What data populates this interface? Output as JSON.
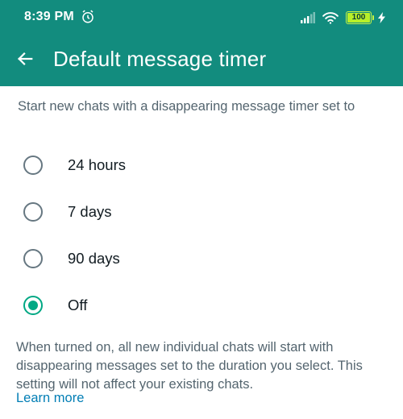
{
  "status_bar": {
    "time": "8:39 PM",
    "battery_level": "100",
    "icons": [
      "alarm-icon",
      "signal-icon",
      "wifi-icon",
      "battery-icon",
      "charging-bolt-icon"
    ]
  },
  "header": {
    "title": "Default message timer",
    "back_icon": "back-arrow-icon",
    "background_color": "#128c7e"
  },
  "intro_text": "Start new chats with a disappearing message timer set to",
  "options": [
    {
      "label": "24 hours",
      "selected": false
    },
    {
      "label": "7 days",
      "selected": false
    },
    {
      "label": "90 days",
      "selected": false
    },
    {
      "label": "Off",
      "selected": true
    }
  ],
  "footer": {
    "note": "When turned on, all new individual chats will start with disappearing messages set to the duration you select. This setting will not affect your existing chats.",
    "learn_more": "Learn more",
    "link_color": "#027eb5"
  },
  "accent_color": "#00a884"
}
